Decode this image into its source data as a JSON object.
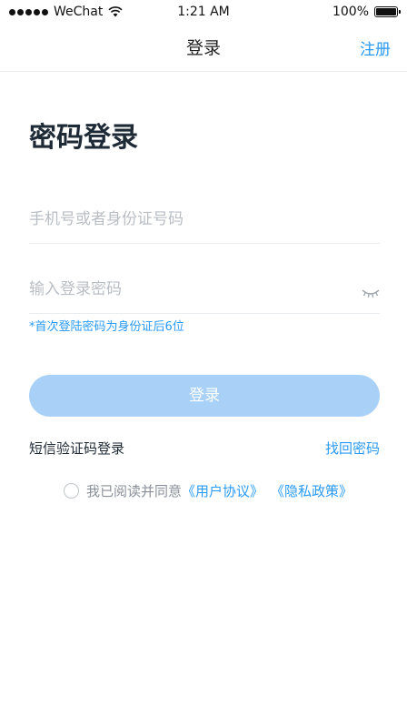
{
  "status_bar": {
    "carrier": "WeChat",
    "time": "1:21 AM",
    "battery": "100%"
  },
  "nav": {
    "title": "登录",
    "register": "注册"
  },
  "page": {
    "title": "密码登录"
  },
  "form": {
    "phone_placeholder": "手机号或者身份证号码",
    "password_placeholder": "输入登录密码",
    "hint": "*首次登陆密码为身份证后6位",
    "login_button": "登录",
    "sms_login": "短信验证码登录",
    "forgot_password": "找回密码"
  },
  "agreement": {
    "prefix": "我已阅读并同意",
    "user_agreement": "《用户协议》",
    "privacy_policy": "《隐私政策》"
  },
  "colors": {
    "accent": "#2b9af3",
    "button_bg": "#a9d1f7",
    "title": "#1f2a37",
    "placeholder": "#b9bec5"
  },
  "icons": {
    "wifi": "wifi-icon",
    "battery": "battery-icon",
    "password_toggle": "eye-closed-icon",
    "agree_radio": "radio-unchecked-icon"
  }
}
